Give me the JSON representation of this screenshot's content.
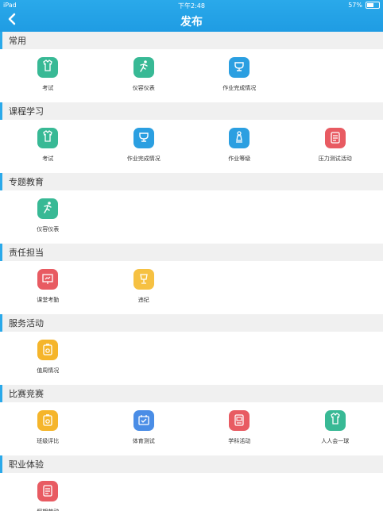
{
  "status": {
    "device": "iPad",
    "time": "下午2:48",
    "battery": "57%",
    "battery_level": 0.57
  },
  "nav": {
    "title": "发布"
  },
  "sections": [
    {
      "title": "常用",
      "items": [
        {
          "label": "考试",
          "color": "#38b995",
          "icon": "shirt-icon"
        },
        {
          "label": "仪容仪表",
          "color": "#38b995",
          "icon": "runner-icon"
        },
        {
          "label": "作业完成情况",
          "color": "#2b9fe1",
          "icon": "trophy-icon"
        }
      ]
    },
    {
      "title": "课程学习",
      "items": [
        {
          "label": "考试",
          "color": "#38b995",
          "icon": "shirt-icon"
        },
        {
          "label": "作业完成情况",
          "color": "#2b9fe1",
          "icon": "trophy-icon"
        },
        {
          "label": "作业等级",
          "color": "#2b9fe1",
          "icon": "chess-icon"
        },
        {
          "label": "压力测试活动",
          "color": "#e85b62",
          "icon": "document-icon"
        }
      ]
    },
    {
      "title": "专题教育",
      "items": [
        {
          "label": "仪容仪表",
          "color": "#38b995",
          "icon": "runner-icon"
        }
      ]
    },
    {
      "title": "责任担当",
      "items": [
        {
          "label": "课堂考勤",
          "color": "#e85b62",
          "icon": "presentation-icon"
        },
        {
          "label": "违纪",
          "color": "#f6c142",
          "icon": "cup-icon"
        }
      ]
    },
    {
      "title": "服务活动",
      "items": [
        {
          "label": "值周情况",
          "color": "#f5b52b",
          "icon": "clipboard-icon"
        }
      ]
    },
    {
      "title": "比赛竞赛",
      "items": [
        {
          "label": "班级评比",
          "color": "#f5b52b",
          "icon": "clipboard-icon"
        },
        {
          "label": "体育测试",
          "color": "#4a8de6",
          "icon": "calendar-icon"
        },
        {
          "label": "学科活动",
          "color": "#e85b62",
          "icon": "form-icon"
        },
        {
          "label": "人人会一球",
          "color": "#38b995",
          "icon": "shirt-icon"
        }
      ]
    },
    {
      "title": "职业体验",
      "items": [
        {
          "label": "假期劳动",
          "color": "#e85b62",
          "icon": "document-icon"
        }
      ]
    }
  ]
}
